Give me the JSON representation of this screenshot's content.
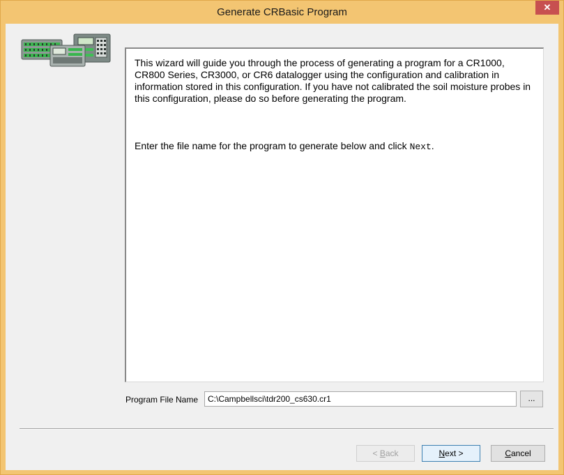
{
  "window": {
    "title": "Generate CRBasic Program",
    "close_glyph": "✕"
  },
  "info": {
    "paragraph1": "This wizard will guide you through the process of generating a program for a CR1000, CR800 Series, CR3000, or CR6 datalogger using the configuration and calibration in information stored in this configuration. If you have not calibrated the soil moisture probes in this configuration, please do so before generating the program.",
    "paragraph2_prefix": "Enter the file name for the program to generate below and click ",
    "paragraph2_keyword": "Next",
    "paragraph2_suffix": "."
  },
  "program_file": {
    "label": "Program File Name",
    "value": "C:\\Campbellsci\\tdr200_cs630.cr1",
    "browse_label": "..."
  },
  "buttons": {
    "back_prefix": "< ",
    "back_mnemonic": "B",
    "back_rest": "ack",
    "next_mnemonic": "N",
    "next_rest": "ext >",
    "cancel_mnemonic": "C",
    "cancel_rest": "ancel"
  },
  "colors": {
    "title_bar": "#f3c572",
    "close_button": "#c75050",
    "dialog_background": "#f0f0f0",
    "default_button_border": "#3c7fb1"
  },
  "icons": {
    "close": "close-icon",
    "device": "datalogger-devices-icon"
  }
}
